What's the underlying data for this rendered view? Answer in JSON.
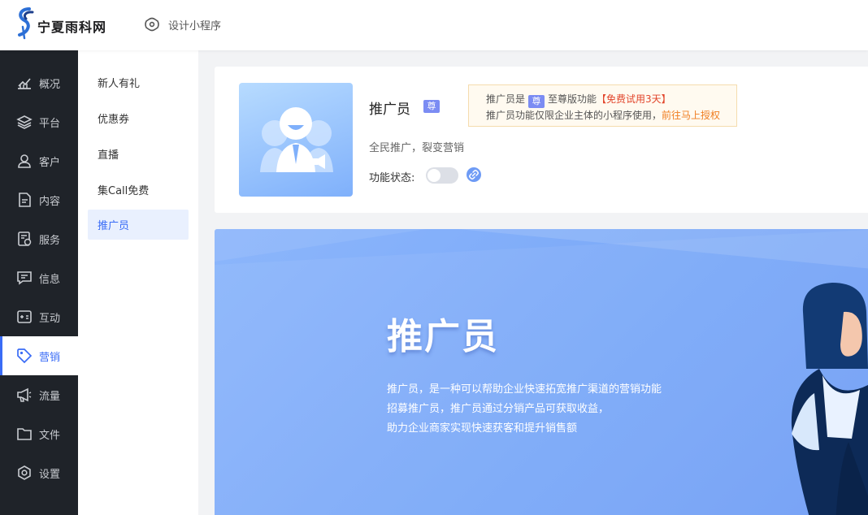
{
  "header": {
    "logo_text": "宁夏雨科网",
    "design_mini_label": "设计小程序"
  },
  "leftnav": {
    "items": [
      {
        "label": "概况",
        "icon": "chart-icon"
      },
      {
        "label": "平台",
        "icon": "layers-icon"
      },
      {
        "label": "客户",
        "icon": "user-icon"
      },
      {
        "label": "内容",
        "icon": "document-icon"
      },
      {
        "label": "服务",
        "icon": "service-icon"
      },
      {
        "label": "信息",
        "icon": "message-icon"
      },
      {
        "label": "互动",
        "icon": "interaction-icon"
      },
      {
        "label": "营销",
        "icon": "tag-icon",
        "active": true
      },
      {
        "label": "流量",
        "icon": "megaphone-icon"
      },
      {
        "label": "文件",
        "icon": "folder-icon"
      },
      {
        "label": "设置",
        "icon": "settings-icon"
      }
    ]
  },
  "submenu": {
    "items": [
      {
        "label": "新人有礼"
      },
      {
        "label": "优惠券"
      },
      {
        "label": "直播"
      },
      {
        "label": "集Call免费"
      },
      {
        "label": "推广员",
        "active": true
      }
    ]
  },
  "feature": {
    "title": "推广员",
    "badge": "尊",
    "description": "全民推广，裂变营销",
    "status_label": "功能状态:",
    "enabled": false
  },
  "notice": {
    "line1_prefix": "推广员是",
    "line1_badge": "尊",
    "line1_text": "至尊版功能",
    "trial_text": "【免费试用3天】",
    "line2_text": "推广员功能仅限企业主体的小程序使用，",
    "auth_link": "前往马上授权"
  },
  "banner": {
    "title": "推广员",
    "lines": [
      "推广员，是一种可以帮助企业快速拓宽推广渠道的营销功能",
      "招募推广员，推广员通过分销产品可获取收益，",
      "助力企业商家实现快速获客和提升销售额"
    ]
  },
  "colors": {
    "accent": "#3a6cf6",
    "nav_bg": "#1f2329",
    "trial_red": "#e2452b",
    "link_orange": "#f07d20"
  }
}
